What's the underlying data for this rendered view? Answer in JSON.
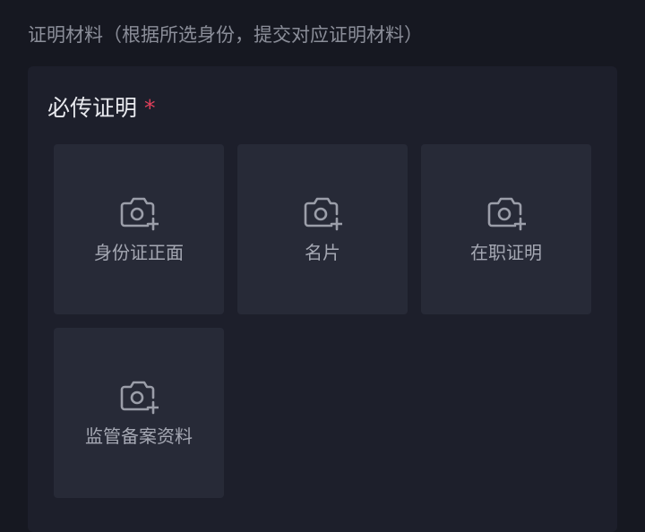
{
  "section": {
    "title": "证明材料（根据所选身份，提交对应证明材料）"
  },
  "card": {
    "heading": "必传证明",
    "required_mark": "*",
    "tiles": [
      {
        "label": "身份证正面",
        "icon": "camera-add-icon"
      },
      {
        "label": "名片",
        "icon": "camera-add-icon"
      },
      {
        "label": "在职证明",
        "icon": "camera-add-icon"
      },
      {
        "label": "监管备案资料",
        "icon": "camera-add-icon"
      }
    ]
  },
  "colors": {
    "page_background": "#161821",
    "card_background": "#1d1f2b",
    "tile_background": "#272a37",
    "required": "#e0405b",
    "icon": "#9b9ea9"
  }
}
